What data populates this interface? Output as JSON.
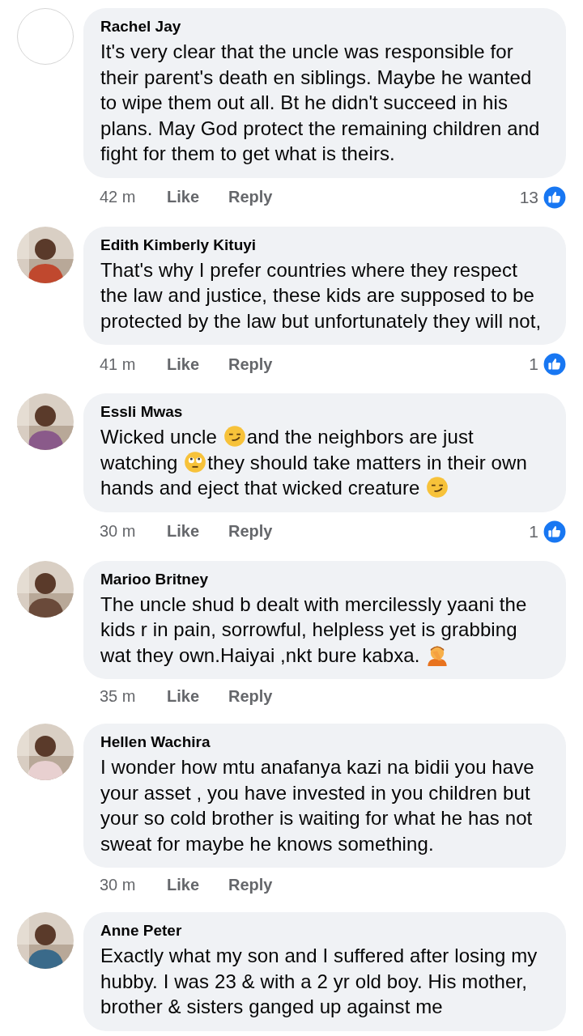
{
  "comments": [
    {
      "name": "Rachel Jay",
      "avatar": {
        "kind": "blank"
      },
      "body": [
        [
          {
            "kind": "text",
            "text": "It's very clear that the uncle was responsible for their parent's death en siblings. Maybe he wanted to wipe them out all. Bt he didn't succeed in his plans. May God protect the remaining children and fight for them to get what is theirs."
          }
        ]
      ],
      "time": "42 m",
      "like": "Like",
      "reply": "Reply",
      "reactions": "13"
    },
    {
      "name": "Edith Kimberly Kituyi",
      "avatar": {
        "kind": "picture"
      },
      "body": [
        [
          {
            "kind": "text",
            "text": "That's why I prefer countries where they respect the law and justice, these kids are supposed to be protected by the law but unfortunately they will not,"
          }
        ]
      ],
      "time": "41 m",
      "like": "Like",
      "reply": "Reply",
      "reactions": "1"
    },
    {
      "name": "Essli Mwas",
      "avatar": {
        "kind": "picture"
      },
      "body": [
        [
          {
            "kind": "text",
            "text": "Wicked uncle "
          },
          {
            "kind": "smirk"
          },
          {
            "kind": "text",
            "text": "and the neighbors are just"
          }
        ],
        [
          {
            "kind": "text",
            "text": "watching "
          },
          {
            "kind": "eyeroll"
          },
          {
            "kind": "text",
            "text": "they should take matters in their own"
          }
        ],
        [
          {
            "kind": "text",
            "text": "hands and eject that wicked creature "
          },
          {
            "kind": "smirk"
          }
        ]
      ],
      "time": "30 m",
      "like": "Like",
      "reply": "Reply",
      "reactions": "1"
    },
    {
      "name": "Marioo Britney",
      "avatar": {
        "kind": "picture"
      },
      "body": [
        [
          {
            "kind": "text",
            "text": "The uncle shud b dealt with mercilessly yaani the"
          }
        ],
        [
          {
            "kind": "text",
            "text": "kids r in pain, sorrowful, helpless yet is grabbing"
          }
        ],
        [
          {
            "kind": "text",
            "text": "wat they own.Haiyai ,nkt bure kabxa. "
          },
          {
            "kind": "facepalm"
          }
        ]
      ],
      "time": "35 m",
      "like": "Like",
      "reply": "Reply"
    },
    {
      "name": "Hellen Wachira",
      "avatar": {
        "kind": "picture"
      },
      "body": [
        [
          {
            "kind": "text",
            "text": "I wonder how mtu anafanya kazi na bidii you have your asset , you have invested in you children but your so cold brother is waiting for what he has not sweat for maybe he knows something."
          }
        ]
      ],
      "time": "30 m",
      "like": "Like",
      "reply": "Reply"
    },
    {
      "name": "Anne Peter",
      "avatar": {
        "kind": "picture"
      },
      "body": [
        [
          {
            "kind": "text",
            "text": "Exactly what my son and I suffered after losing my hubby. I was 23 & with a 2 yr old boy. His mother, brother & sisters ganged up against me"
          }
        ]
      ]
    }
  ]
}
